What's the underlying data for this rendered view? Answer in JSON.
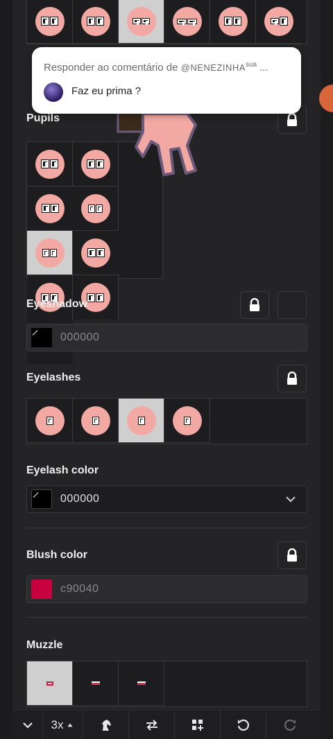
{
  "popup": {
    "prefix": "Responder ao comentário de",
    "username": "@NENEZINHA",
    "suffix": "sua",
    "ellipsis": "...",
    "message": "Faz eu prima ?"
  },
  "sections": {
    "pupils": "Pupils",
    "eyeshadow": "Eyeshadow",
    "eyelashes": "Eyelashes",
    "eyelash_color": "Eyelash color",
    "blush_color": "Blush color",
    "muzzle": "Muzzle"
  },
  "eyeshadow": {
    "value": "000000",
    "swatch": "#000000"
  },
  "eyelash_color": {
    "value": "000000",
    "swatch": "#000000"
  },
  "blush_color": {
    "value": "c90040",
    "swatch": "#c90040"
  },
  "pupils_more": "...",
  "toolbar": {
    "zoom": "3x"
  },
  "colors": {
    "background": "#242426",
    "face": "#f2a9a3",
    "selected": "#cfcfcf",
    "accent_orange": "#e06a3a"
  }
}
